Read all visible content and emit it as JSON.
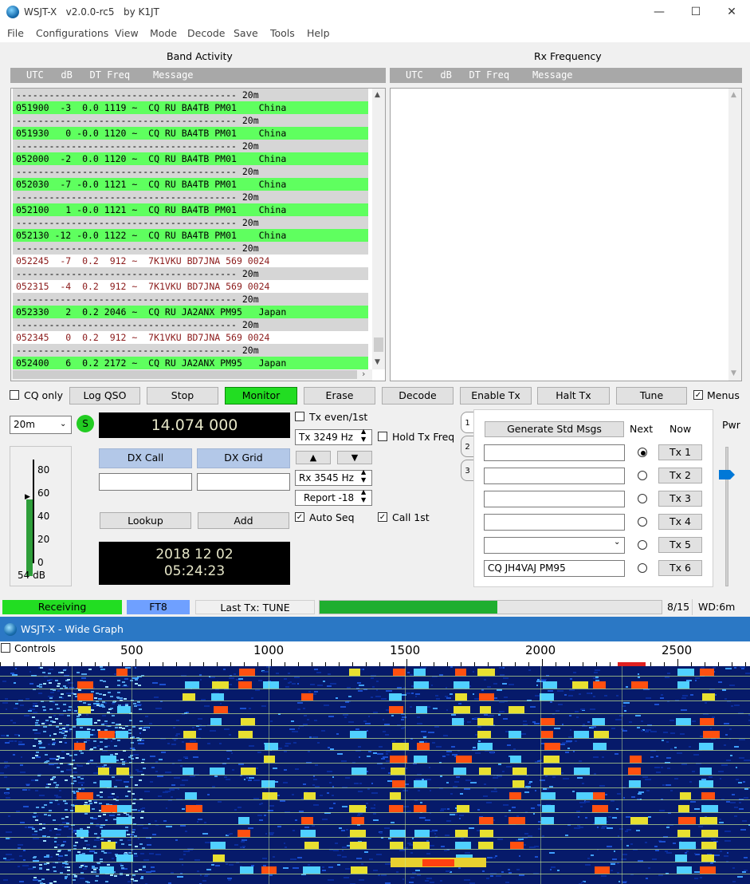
{
  "window": {
    "title": "WSJT-X   v2.0.0-rc5   by K1JT",
    "minimize": "—",
    "maximize": "☐",
    "close": "✕"
  },
  "menu": [
    "File",
    "Configurations",
    "View",
    "Mode",
    "Decode",
    "Save",
    "Tools",
    "Help"
  ],
  "band_activity": {
    "title": "Band Activity",
    "header": "UTC   dB   DT Freq    Message",
    "lines": [
      {
        "type": "sep",
        "text": "---------------------------------------- 20m"
      },
      {
        "type": "cq",
        "text": "051900  -3  0.0 1119 ~  CQ RU BA4TB PM01    China"
      },
      {
        "type": "sep",
        "text": "---------------------------------------- 20m"
      },
      {
        "type": "cq",
        "text": "051930   0 -0.0 1120 ~  CQ RU BA4TB PM01    China"
      },
      {
        "type": "sep",
        "text": "---------------------------------------- 20m"
      },
      {
        "type": "cq",
        "text": "052000  -2  0.0 1120 ~  CQ RU BA4TB PM01    China"
      },
      {
        "type": "sep",
        "text": "---------------------------------------- 20m"
      },
      {
        "type": "cq",
        "text": "052030  -7 -0.0 1121 ~  CQ RU BA4TB PM01    China"
      },
      {
        "type": "sep",
        "text": "---------------------------------------- 20m"
      },
      {
        "type": "cq",
        "text": "052100   1 -0.0 1121 ~  CQ RU BA4TB PM01    China"
      },
      {
        "type": "sep",
        "text": "---------------------------------------- 20m"
      },
      {
        "type": "cq",
        "text": "052130 -12 -0.0 1122 ~  CQ RU BA4TB PM01    China"
      },
      {
        "type": "sep",
        "text": "---------------------------------------- 20m"
      },
      {
        "type": "tx",
        "text": "052245  -7  0.2  912 ~  7K1VKU BD7JNA 569 0024"
      },
      {
        "type": "sep",
        "text": "---------------------------------------- 20m"
      },
      {
        "type": "tx",
        "text": "052315  -4  0.2  912 ~  7K1VKU BD7JNA 569 0024"
      },
      {
        "type": "sep",
        "text": "---------------------------------------- 20m"
      },
      {
        "type": "cq",
        "text": "052330   2  0.2 2046 ~  CQ RU JA2ANX PM95   Japan"
      },
      {
        "type": "sep",
        "text": "---------------------------------------- 20m"
      },
      {
        "type": "tx",
        "text": "052345   0  0.2  912 ~  7K1VKU BD7JNA 569 0024"
      },
      {
        "type": "sep",
        "text": "---------------------------------------- 20m"
      },
      {
        "type": "cq",
        "text": "052400   6  0.2 2172 ~  CQ RU JA2ANX PM95   Japan"
      }
    ]
  },
  "rx_frequency": {
    "title": "Rx Frequency",
    "header": "UTC   dB   DT Freq    Message"
  },
  "controls": {
    "cq_only": "CQ only",
    "log_qso": "Log QSO",
    "stop": "Stop",
    "monitor": "Monitor",
    "erase": "Erase",
    "decode": "Decode",
    "enable_tx": "Enable Tx",
    "halt_tx": "Halt Tx",
    "tune": "Tune",
    "menus": "Menus"
  },
  "band": "20m",
  "s_badge": "S",
  "dial_frequency": "14.074 000",
  "meter": {
    "ticks": [
      "80",
      "60",
      "40",
      "20",
      "0"
    ],
    "level_db": "54 dB",
    "level_fraction": 0.55
  },
  "dx": {
    "call_label": "DX Call",
    "grid_label": "DX Grid",
    "call_value": "",
    "grid_value": "",
    "lookup": "Lookup",
    "add": "Add"
  },
  "clock": {
    "date": "2018 12 02",
    "time": "05:24:23"
  },
  "tx_panel": {
    "tx_even": "Tx even/1st",
    "tx_freq": "Tx  3249  Hz",
    "hold_tx_freq": "Hold Tx Freq",
    "up_arrow": "▲",
    "down_arrow": "▼",
    "rx_freq": "Rx  3545  Hz",
    "report": "Report -18",
    "auto_seq": "Auto Seq",
    "call_1st": "Call 1st"
  },
  "tabs": [
    "1",
    "2",
    "3"
  ],
  "messages": {
    "generate": "Generate Std Msgs",
    "next": "Next",
    "now": "Now",
    "rows": [
      {
        "value": "",
        "button": "Tx 1",
        "selected": true
      },
      {
        "value": "",
        "button": "Tx 2",
        "selected": false
      },
      {
        "value": "",
        "button": "Tx 3",
        "selected": false
      },
      {
        "value": "",
        "button": "Tx 4",
        "selected": false
      },
      {
        "value": "",
        "button": "Tx 5",
        "selected": false
      },
      {
        "value": "CQ JH4VAJ PM95",
        "button": "Tx 6",
        "selected": false
      }
    ]
  },
  "pwr_label": "Pwr",
  "status": {
    "receiving": "Receiving",
    "mode": "FT8",
    "last_tx": "Last Tx: TUNE",
    "progress_fraction": 0.52,
    "period": "8/15",
    "wd": "WD:6m"
  },
  "wide_graph": {
    "title": "WSJT-X - Wide Graph",
    "controls": "Controls",
    "ticks": [
      "500",
      "1000",
      "1500",
      "2000",
      "2500"
    ]
  },
  "colors": {
    "cq_highlight": "#5fff5f",
    "tx_text": "#8b1a1a",
    "monitor_on": "#22dd22",
    "receiving": "#22dd22",
    "mode_badge": "#6fa0ff",
    "progress": "#1fae2f",
    "wide_graph_title": "#2b78c5"
  }
}
